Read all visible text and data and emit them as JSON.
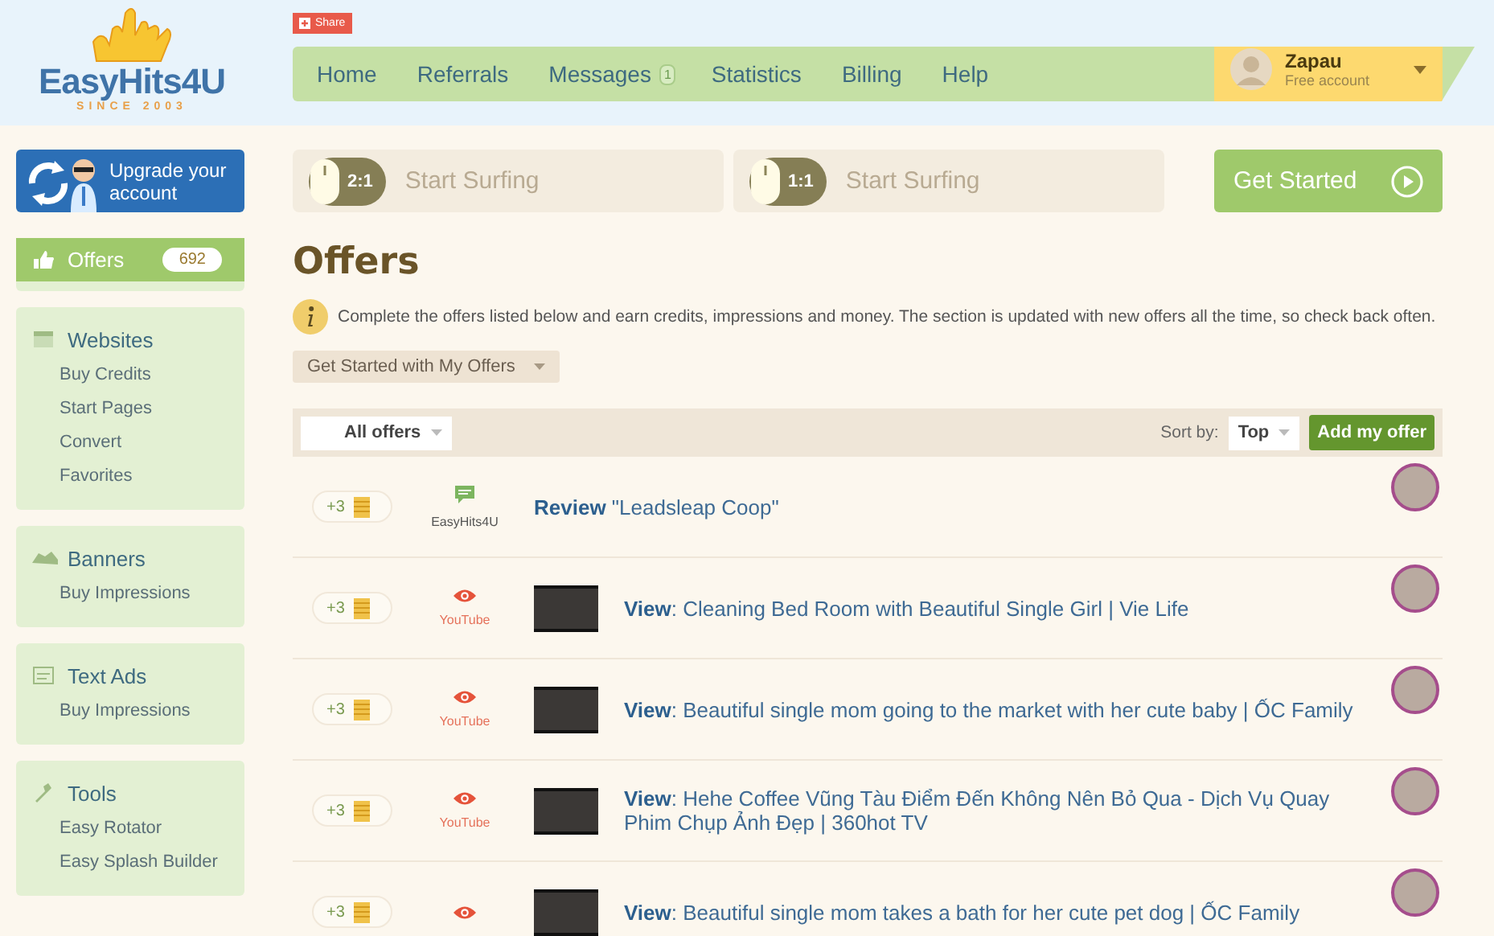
{
  "logo": {
    "name": "EasyHits4U",
    "since": "SINCE 2003"
  },
  "share": {
    "label": "Share"
  },
  "nav": [
    {
      "label": "Home"
    },
    {
      "label": "Referrals"
    },
    {
      "label": "Messages",
      "badge": "1"
    },
    {
      "label": "Statistics"
    },
    {
      "label": "Billing"
    },
    {
      "label": "Help"
    }
  ],
  "user": {
    "name": "Zapau",
    "plan": "Free account"
  },
  "upgrade": {
    "label": "Upgrade your account"
  },
  "surf": [
    {
      "ratio": "2:1",
      "label": "Start Surfing"
    },
    {
      "ratio": "1:1",
      "label": "Start Surfing"
    }
  ],
  "get_started": {
    "label": "Get Started"
  },
  "sidebar": [
    {
      "kind": "offers",
      "title": "Offers",
      "count": "692",
      "selected": true
    },
    {
      "kind": "websites",
      "title": "Websites",
      "selected": false,
      "items": [
        "Buy Credits",
        "Start Pages",
        "Convert",
        "Favorites"
      ]
    },
    {
      "kind": "banners",
      "title": "Banners",
      "selected": false,
      "items": [
        "Buy Impressions"
      ]
    },
    {
      "kind": "textads",
      "title": "Text Ads",
      "selected": false,
      "items": [
        "Buy Impressions"
      ]
    },
    {
      "kind": "tools",
      "title": "Tools",
      "selected": false,
      "items": [
        "Easy Rotator",
        "Easy Splash Builder"
      ]
    }
  ],
  "page_title": "Offers",
  "intro": "Complete the offers listed below and earn credits, impressions and money. The section is updated with new offers all the time, so check back often.",
  "my_offers": {
    "label": "Get Started with My Offers"
  },
  "filter": {
    "label": "All offers"
  },
  "sort": {
    "label": "Sort by:",
    "value": "Top"
  },
  "add_offer": {
    "label": "Add my offer"
  },
  "offers": [
    {
      "kind": "review",
      "credits": "+3",
      "source": "EasyHits4U",
      "text": "**Review** \"Leadsleap Coop\""
    },
    {
      "kind": "view",
      "credits": "+3",
      "source": "YouTube",
      "text": "**View**: Cleaning Bed Room with Beautiful Single Girl | Vie Life"
    },
    {
      "kind": "view",
      "credits": "+3",
      "source": "YouTube",
      "text": "**View**: Beautiful single mom going to the market with her cute baby | ỐC Family"
    },
    {
      "kind": "view",
      "credits": "+3",
      "source": "YouTube",
      "text": "**View**: Hehe Coffee Vũng Tàu Điểm Đến Không Nên Bỏ Qua - Dịch Vụ Quay Phim Chụp Ảnh Đẹp | 360hot TV"
    },
    {
      "kind": "view",
      "credits": "+3",
      "text": "**View**: Beautiful single mom takes a bath for her cute pet dog | ỐC Family"
    }
  ]
}
